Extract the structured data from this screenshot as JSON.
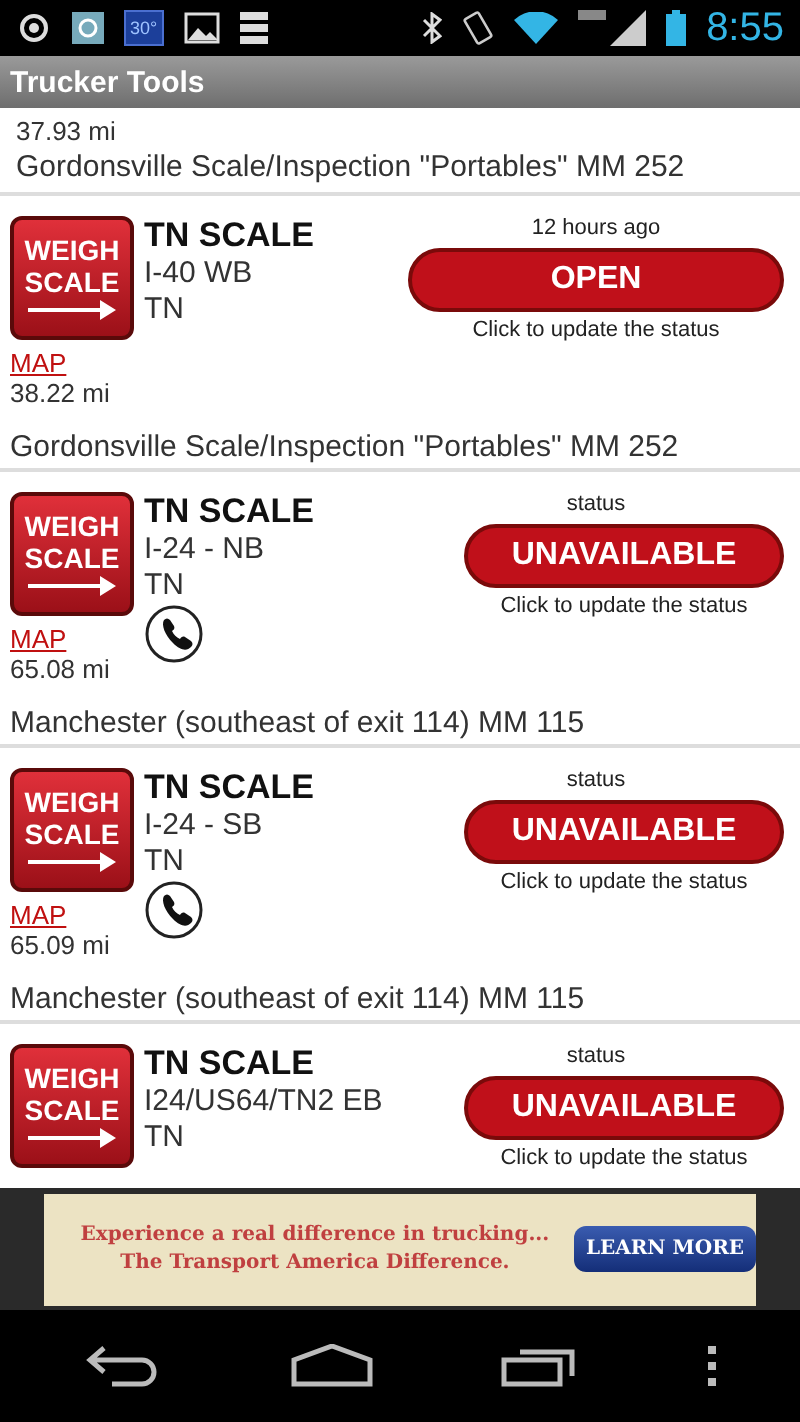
{
  "status_bar": {
    "weather": "30°",
    "time": "8:55"
  },
  "app_bar": {
    "title": "Trucker Tools"
  },
  "partial_item": {
    "distance": "37.93 mi",
    "description": "Gordonsville Scale/Inspection \"Portables\" MM 252"
  },
  "items": [
    {
      "sign_top": "WEIGH",
      "sign_bottom": "SCALE",
      "title": "TN SCALE",
      "road": "I-40 WB",
      "state": "TN",
      "phone": false,
      "status_caption": "12 hours ago",
      "status": "OPEN",
      "hint": "Click to update the status",
      "map": "MAP",
      "distance": "38.22 mi",
      "description": "Gordonsville Scale/Inspection \"Portables\" MM 252"
    },
    {
      "sign_top": "WEIGH",
      "sign_bottom": "SCALE",
      "title": "TN SCALE",
      "road": "I-24 - NB",
      "state": "TN",
      "phone": true,
      "status_caption": "status",
      "status": "UNAVAILABLE",
      "hint": "Click to update the status",
      "map": "MAP",
      "distance": "65.08 mi",
      "description": "Manchester (southeast of exit 114) MM 115"
    },
    {
      "sign_top": "WEIGH",
      "sign_bottom": "SCALE",
      "title": "TN SCALE",
      "road": "I-24 - SB",
      "state": "TN",
      "phone": true,
      "status_caption": "status",
      "status": "UNAVAILABLE",
      "hint": "Click to update the status",
      "map": "MAP",
      "distance": "65.09 mi",
      "description": "Manchester (southeast of exit 114) MM 115"
    },
    {
      "sign_top": "WEIGH",
      "sign_bottom": "SCALE",
      "title": "TN SCALE",
      "road": "I24/US64/TN2 EB",
      "state": "TN",
      "phone": false,
      "status_caption": "status",
      "status": "UNAVAILABLE",
      "hint": "Click to update the status"
    }
  ],
  "ad": {
    "line_1": "Experience a real difference in trucking...",
    "line_2": "The Transport America Difference.",
    "button": "LEARN MORE"
  }
}
